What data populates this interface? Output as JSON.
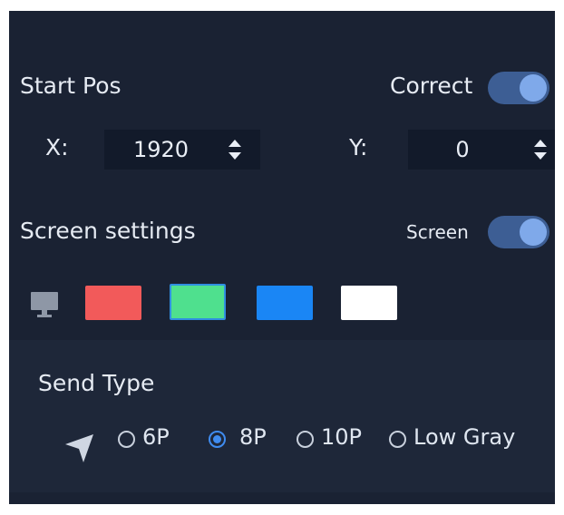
{
  "start_pos": {
    "title": "Start Pos",
    "correct_label": "Correct",
    "correct_on": true,
    "x_label": "X:",
    "x_value": "1920",
    "y_label": "Y:",
    "y_value": "0"
  },
  "screen_settings": {
    "title": "Screen settings",
    "screen_label": "Screen",
    "screen_on": true,
    "monitor_icon": "monitor-icon",
    "swatches": [
      {
        "name": "red",
        "color": "#f25a5a"
      },
      {
        "name": "green",
        "color": "#4fe08e",
        "selected": true
      },
      {
        "name": "blue",
        "color": "#1a86f5"
      },
      {
        "name": "white",
        "color": "#ffffff"
      }
    ]
  },
  "send_type": {
    "title": "Send Type",
    "icon": "send-arrow-icon",
    "options": [
      {
        "label": "6P",
        "checked": false
      },
      {
        "label": "8P",
        "checked": true
      },
      {
        "label": "10P",
        "checked": false
      },
      {
        "label": "Low Gray",
        "checked": false
      }
    ]
  }
}
